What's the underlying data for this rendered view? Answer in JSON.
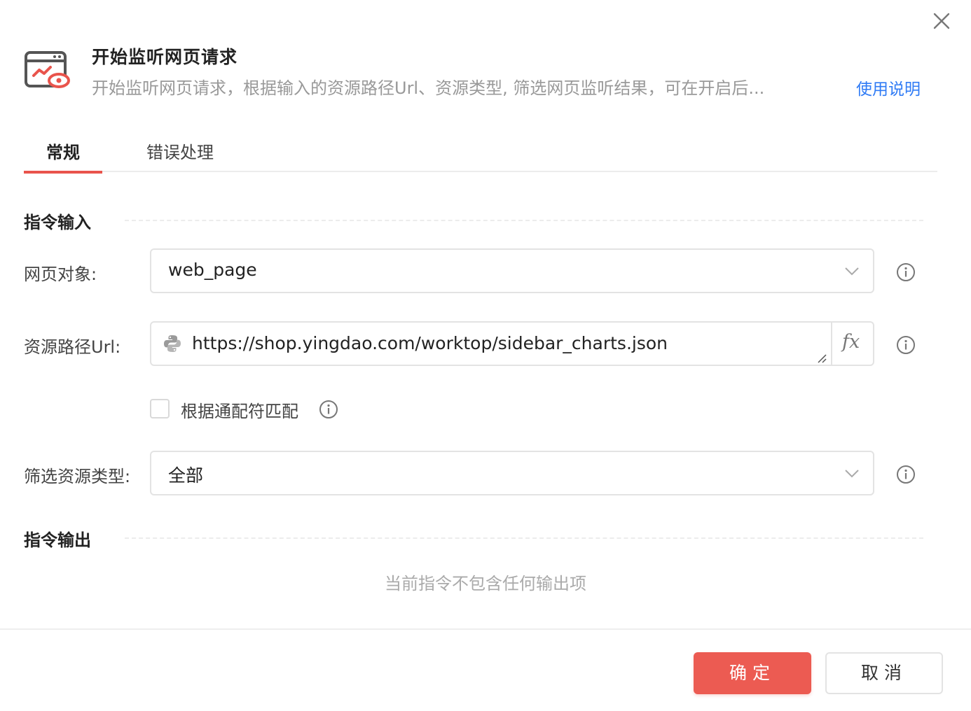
{
  "header": {
    "title": "开始监听网页请求",
    "description": "开始监听网页请求，根据输入的资源路径Url、资源类型, 筛选网页监听结果，可在开启后...",
    "help_link": "使用说明",
    "icon": "monitor-eye-icon"
  },
  "tabs": [
    {
      "label": "常规",
      "active": true
    },
    {
      "label": "错误处理",
      "active": false
    }
  ],
  "input_section": {
    "title": "指令输入",
    "web_object": {
      "label": "网页对象:",
      "value": "web_page"
    },
    "resource_url": {
      "label": "资源路径Url:",
      "value": "https://shop.yingdao.com/worktop/sidebar_charts.json",
      "fx_label": "fx"
    },
    "wildcard_match": {
      "label": "根据通配符匹配",
      "checked": false
    },
    "resource_type": {
      "label": "筛选资源类型:",
      "value": "全部"
    }
  },
  "output_section": {
    "title": "指令输出",
    "empty_text": "当前指令不包含任何输出项"
  },
  "footer": {
    "ok_label": "确定",
    "cancel_label": "取消"
  },
  "colors": {
    "accent": "#ec5b52",
    "link": "#2f7bf5"
  }
}
